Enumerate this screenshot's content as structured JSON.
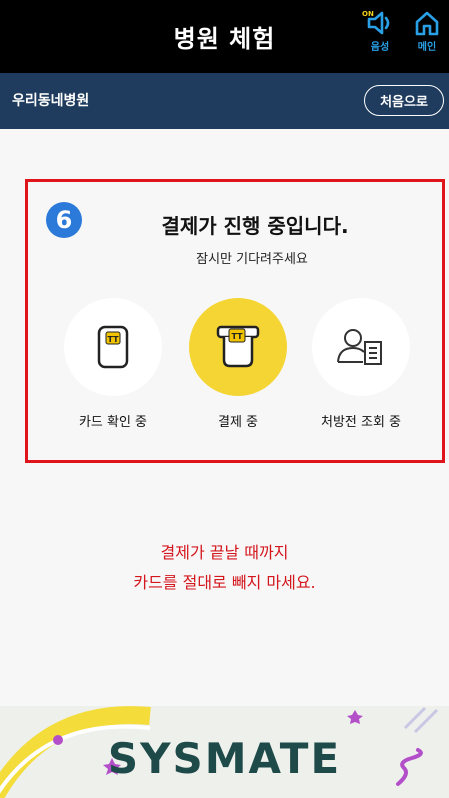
{
  "header": {
    "title": "병원 체험",
    "voice_label": "음성",
    "voice_on": "ON",
    "home_label": "메인",
    "voice_icon": "speaker-icon",
    "home_icon": "home-icon"
  },
  "subbar": {
    "hospital_name": "우리동네병원",
    "restart_label": "처음으로"
  },
  "status": {
    "step_number": "6",
    "title": "결제가 진행 중입니다.",
    "subtitle": "잠시만 기다려주세요",
    "steps": [
      {
        "label": "카드 확인 중",
        "icon": "card-insert-icon",
        "active": false
      },
      {
        "label": "결제 중",
        "icon": "card-payment-icon",
        "active": true
      },
      {
        "label": "처방전 조회 중",
        "icon": "prescription-user-icon",
        "active": false
      }
    ]
  },
  "warning": {
    "line1": "결제가 끝날 때까지",
    "line2": "카드를 절대로 빼지 마세요."
  },
  "banner": {
    "brand": "SYSMATE"
  },
  "colors": {
    "header_bg": "#000000",
    "subbar_bg": "#1f3c5e",
    "accent_yellow": "#f5d534",
    "alert_red": "#e0141b",
    "badge_blue": "#2b79d8",
    "icon_blue": "#2aa0e6"
  }
}
